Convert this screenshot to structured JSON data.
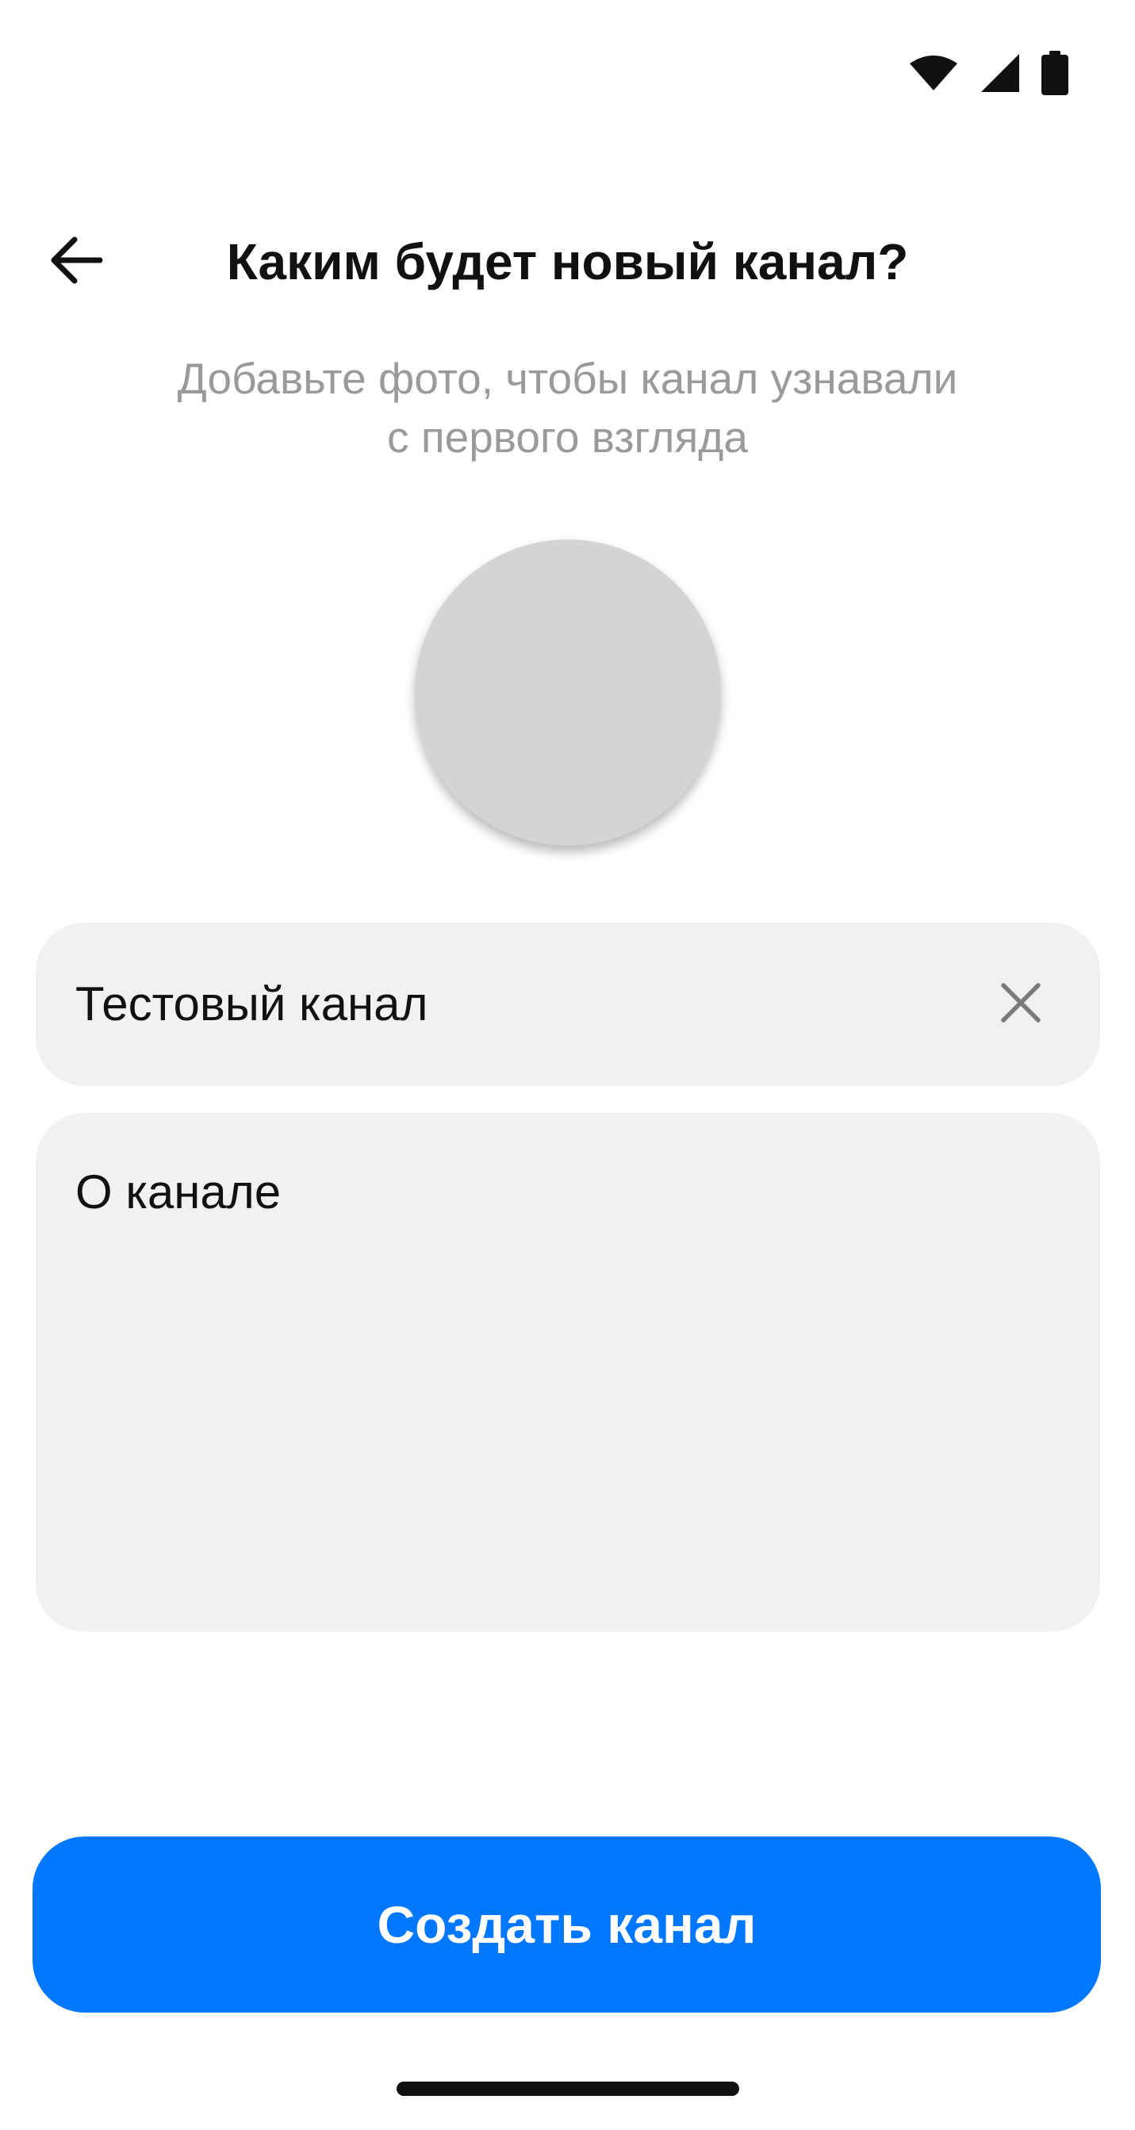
{
  "status_bar": {
    "icons": [
      "wifi-icon",
      "cellular-signal-icon",
      "battery-icon"
    ]
  },
  "header": {
    "back_icon": "arrow-left-icon",
    "title": "Каким будет новый канал?"
  },
  "subtitle": {
    "line1": "Добавьте фото, чтобы канал узнавали",
    "line2": "с первого взгляда"
  },
  "avatar": {
    "placeholder_color": "#d4d4d4"
  },
  "name_field": {
    "value": "Тестовый канал",
    "clear_icon": "close-icon"
  },
  "about_field": {
    "placeholder": "О канале",
    "value": ""
  },
  "create_button": {
    "label": "Создать канал",
    "color": "#0077ff"
  }
}
